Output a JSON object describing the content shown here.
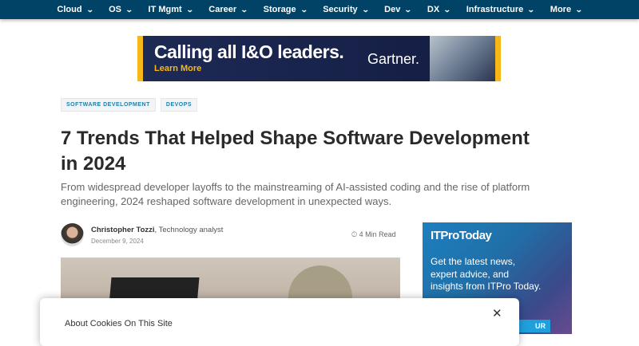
{
  "nav": {
    "items": [
      "Cloud",
      "OS",
      "IT Mgmt",
      "Career",
      "Storage",
      "Security",
      "Dev",
      "DX",
      "Infrastructure",
      "More"
    ]
  },
  "ad": {
    "headline": "Calling all I&O leaders.",
    "cta": "Learn More",
    "brand": "Gartner."
  },
  "article": {
    "tags": [
      "SOFTWARE DEVELOPMENT",
      "DEVOPS"
    ],
    "title": "7 Trends That Helped Shape Software Development in 2024",
    "dek": "From widespread developer layoffs to the mainstreaming of AI-assisted coding and the rise of platform engineering, 2024 reshaped software development in unexpected ways.",
    "author": "Christopher Tozzi",
    "author_role": ", Technology analyst",
    "date": "December 9, 2024",
    "read_time": "4 Min Read"
  },
  "side_ad": {
    "logo": "ITProToday",
    "text": "Get the latest news, expert advice, and insights from ITPro Today.",
    "button": "UR"
  },
  "cookie": {
    "title": "About Cookies On This Site",
    "close": "✕"
  }
}
